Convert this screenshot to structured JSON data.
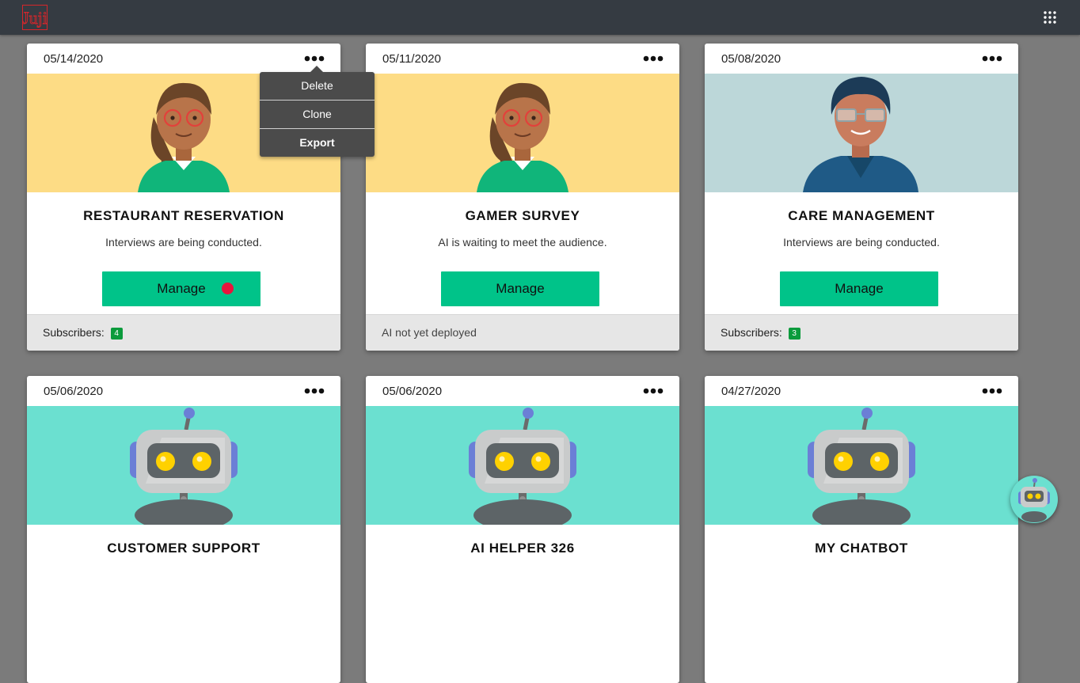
{
  "app": {
    "logo_text": "Juji",
    "apps_icon": "grid-icon"
  },
  "colors": {
    "topbar": "#353b42",
    "accent_green": "#00c389",
    "alert_red": "#e8153d",
    "badge_green": "#0b9b3c",
    "avatar_yellow_bg": "#fddc85",
    "avatar_blue_bg": "#bcd7d9",
    "robot_bg": "#6be0d0"
  },
  "dropdown": {
    "items": [
      "Delete",
      "Clone",
      "Export"
    ]
  },
  "cards": [
    {
      "date": "05/14/2020",
      "avatar": "woman-avatar",
      "title": "RESTAURANT RESERVATION",
      "status": "Interviews are being conducted.",
      "manage_label": "Manage",
      "has_alert": true,
      "footer_label": "Subscribers:",
      "subscribers": "4"
    },
    {
      "date": "05/11/2020",
      "avatar": "woman-avatar",
      "title": "GAMER SURVEY",
      "status": "AI is waiting to meet the audience.",
      "manage_label": "Manage",
      "has_alert": false,
      "footer_label": "AI not yet deployed"
    },
    {
      "date": "05/08/2020",
      "avatar": "man-avatar",
      "title": "CARE MANAGEMENT",
      "status": "Interviews are being conducted.",
      "manage_label": "Manage",
      "has_alert": false,
      "footer_label": "Subscribers:",
      "subscribers": "3"
    },
    {
      "date": "05/06/2020",
      "avatar": "robot-avatar",
      "title": "CUSTOMER SUPPORT"
    },
    {
      "date": "05/06/2020",
      "avatar": "robot-avatar",
      "title": "AI HELPER 326"
    },
    {
      "date": "04/27/2020",
      "avatar": "robot-avatar",
      "title": "MY CHATBOT"
    }
  ],
  "chatbot_fab": {
    "icon": "robot-icon"
  }
}
